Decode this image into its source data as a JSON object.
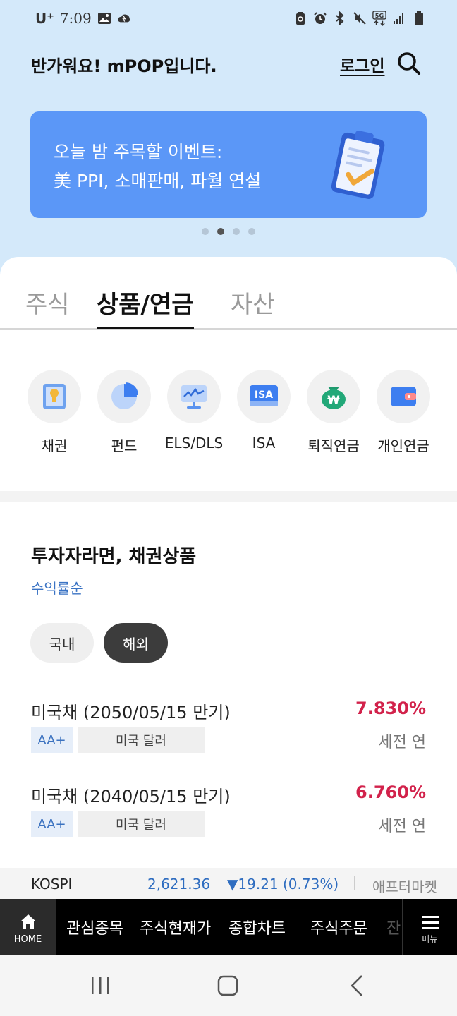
{
  "status_bar": {
    "carrier": "U⁺",
    "time": "7:09",
    "icons": [
      "gallery-icon",
      "cloud-icon",
      "battery-saver-icon",
      "alarm-icon",
      "bluetooth-icon",
      "mute-icon",
      "5g-icon",
      "signal-icon",
      "battery-icon"
    ]
  },
  "header": {
    "greeting": "반가워요! mPOP입니다.",
    "login": "로그인"
  },
  "banner": {
    "line1": "오늘 밤 주목할 이벤트:",
    "line2": "美 PPI, 소매판매, 파월 연설",
    "page_count": 4,
    "active_page": 2
  },
  "tabs": [
    {
      "label": "주식",
      "active": false
    },
    {
      "label": "상품/연금",
      "active": true
    },
    {
      "label": "자산",
      "active": false
    }
  ],
  "categories": [
    {
      "label": "채권",
      "icon": "bond-icon"
    },
    {
      "label": "펀드",
      "icon": "fund-pie-icon"
    },
    {
      "label": "ELS/DLS",
      "icon": "els-chart-icon"
    },
    {
      "label": "ISA",
      "icon": "isa-icon",
      "icon_text": "ISA"
    },
    {
      "label": "퇴직연금",
      "icon": "retirement-pension-icon",
      "icon_text": "₩"
    },
    {
      "label": "개인연금",
      "icon": "personal-pension-wallet-icon"
    }
  ],
  "section": {
    "title": "투자자라면, 채권상품",
    "sort": "수익률순",
    "chips": [
      {
        "label": "국내",
        "selected": false
      },
      {
        "label": "해외",
        "selected": true
      }
    ],
    "items": [
      {
        "name": "미국채 (2050/05/15 만기)",
        "rate": "7.830%",
        "grade": "AA+",
        "currency": "미국 달러",
        "tax": "세전 연"
      },
      {
        "name": "미국채 (2040/05/15 만기)",
        "rate": "6.760%",
        "grade": "AA+",
        "currency": "미국 달러",
        "tax": "세전 연"
      }
    ]
  },
  "ticker": {
    "name": "KOSPI",
    "value": "2,621.36",
    "change": "▼19.21 (0.73%)",
    "after": "애프터마켓"
  },
  "bottom_nav": {
    "home": "HOME",
    "items": [
      "관심종목",
      "주식현재가",
      "종합차트",
      "주식주문"
    ],
    "faded": "잔",
    "menu": "메뉴"
  },
  "colors": {
    "background": "#d4e9fa",
    "banner": "#5b97f7",
    "accent_blue": "#3a73c4",
    "rate_red": "#d2224b"
  }
}
